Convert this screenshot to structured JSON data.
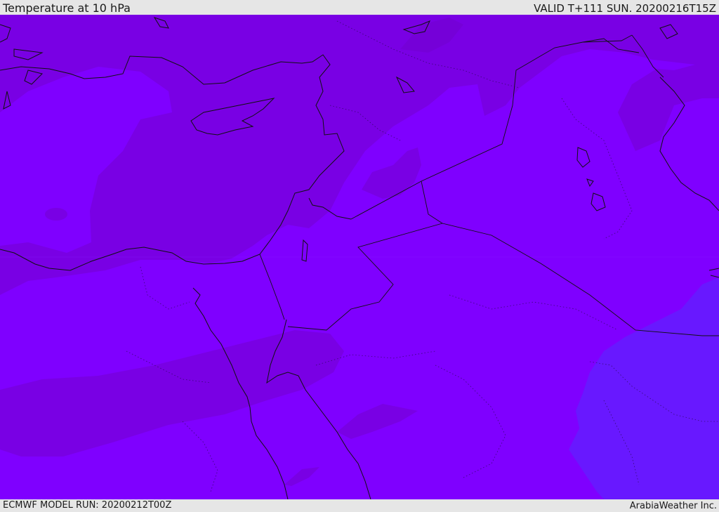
{
  "header": {
    "title": "Temperature at 10 hPa",
    "valid": "VALID T+111 SUN. 20200216T15Z"
  },
  "footer": {
    "model_run": "ECMWF MODEL RUN: 20200212T00Z",
    "credit": "ArabiaWeather Inc."
  },
  "map": {
    "region": "Eastern Mediterranean and Middle East",
    "colors": {
      "base_violet": "#7f00ff",
      "warm_purple": "#7a00e6",
      "warmer_purple": "#7d00d6",
      "cool_blue_violet": "#6818ff",
      "border_line": "#111111"
    }
  }
}
